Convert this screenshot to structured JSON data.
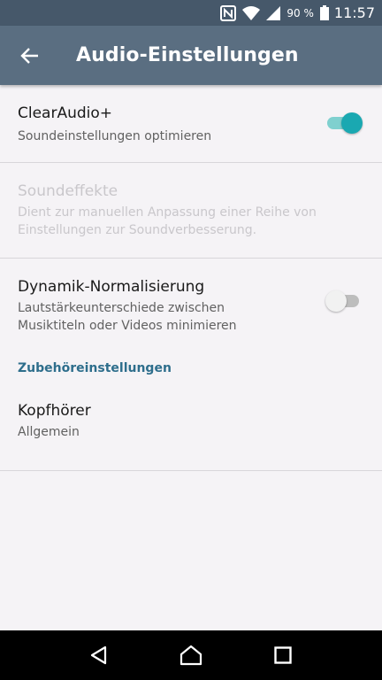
{
  "status_bar": {
    "battery_percent": "90 %",
    "time": "11:57",
    "icons": [
      "nfc-icon",
      "wifi-icon",
      "signal-icon",
      "battery-icon"
    ]
  },
  "app_bar": {
    "title": "Audio-Einstellungen",
    "back_icon": "arrow-back-icon",
    "background_color": "#5a6e81"
  },
  "settings": {
    "clearaudio": {
      "title": "ClearAudio+",
      "summary": "Soundeinstellungen optimieren",
      "enabled": true
    },
    "soundeffekte": {
      "title": "Soundeffekte",
      "summary": "Dient zur manuellen Anpassung einer Reihe von Einstellungen zur Soundverbesserung.",
      "disabled": true
    },
    "dynamik": {
      "title": "Dynamik-Normalisierung",
      "summary": "Lautstärkeunterschiede zwischen Musiktiteln oder Videos minimieren",
      "enabled": false
    },
    "section_header": "Zubehöreinstellungen",
    "kopfhoerer": {
      "title": "Kopfhörer",
      "summary": "Allgemein"
    }
  },
  "accent_color": "#1aa8b1",
  "nav_bar": {
    "icons": [
      "back-triangle-icon",
      "home-icon",
      "recents-icon"
    ]
  }
}
